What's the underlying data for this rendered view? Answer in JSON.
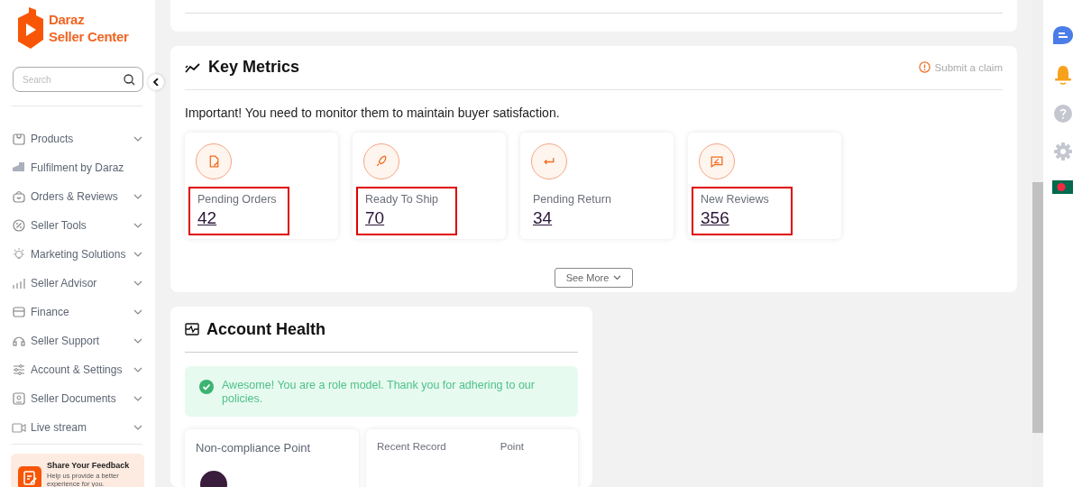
{
  "sidebar": {
    "logo": {
      "name": "Daraz",
      "subtitle": "Seller Center"
    },
    "search": {
      "placeholder": "Search"
    },
    "items": [
      {
        "label": "Products",
        "expandable": true
      },
      {
        "label": "Fulfilment by Daraz",
        "expandable": false
      },
      {
        "label": "Orders & Reviews",
        "expandable": true
      },
      {
        "label": "Seller Tools",
        "expandable": true
      },
      {
        "label": "Marketing Solutions",
        "expandable": true
      },
      {
        "label": "Seller Advisor",
        "expandable": true
      },
      {
        "label": "Finance",
        "expandable": true
      },
      {
        "label": "Seller Support",
        "expandable": true
      },
      {
        "label": "Account & Settings",
        "expandable": true
      },
      {
        "label": "Seller Documents",
        "expandable": true
      },
      {
        "label": "Live stream",
        "expandable": true
      }
    ],
    "feedback": {
      "title": "Share Your Feedback",
      "text": "Help us provide a better experience for you."
    }
  },
  "key_metrics": {
    "title": "Key Metrics",
    "claim_link": "Submit a claim",
    "note": "Important! You need to monitor them to maintain buyer satisfaction.",
    "metrics": [
      {
        "label": "Pending Orders",
        "value": "42",
        "highlighted": true
      },
      {
        "label": "Ready To Ship",
        "value": "70",
        "highlighted": true
      },
      {
        "label": "Pending Return",
        "value": "34",
        "highlighted": false
      },
      {
        "label": "New Reviews",
        "value": "356",
        "highlighted": true
      }
    ],
    "see_more": "See More"
  },
  "account_health": {
    "title": "Account Health",
    "alert": "Awesome! You are a role model. Thank you for adhering to our policies.",
    "noncompliance_title": "Non-compliance Point",
    "record_columns": [
      "Recent Record",
      "Point"
    ]
  }
}
